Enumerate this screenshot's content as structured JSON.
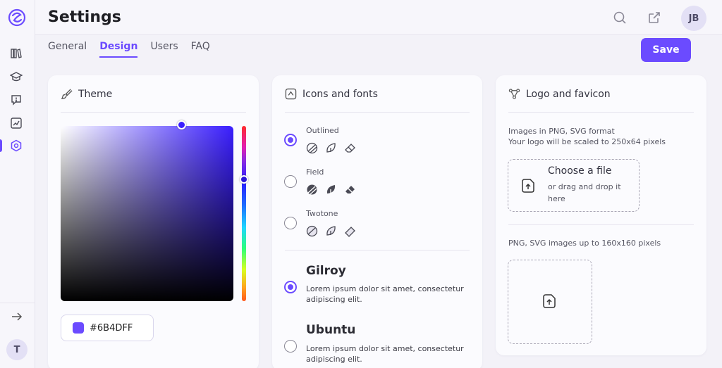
{
  "header": {
    "title": "Settings",
    "avatar_initials": "JB"
  },
  "sidebar": {
    "user_initial": "T"
  },
  "tabs": [
    {
      "label": "General",
      "active": false
    },
    {
      "label": "Design",
      "active": true
    },
    {
      "label": "Users",
      "active": false
    },
    {
      "label": "FAQ",
      "active": false
    }
  ],
  "toolbar": {
    "save_label": "Save"
  },
  "colors": {
    "accent": "#6B4BFF"
  },
  "theme": {
    "title": "Theme",
    "hex_value": "#6B4DFF"
  },
  "icons_fonts": {
    "title": "Icons and fonts",
    "icon_styles": [
      {
        "label": "Outlined",
        "selected": true
      },
      {
        "label": "Field",
        "selected": false
      },
      {
        "label": "Twotone",
        "selected": false
      }
    ],
    "fonts": [
      {
        "name": "Gilroy",
        "description": "Lorem ipsum dolor sit amet, consectetur adipiscing elit.",
        "selected": true
      },
      {
        "name": "Ubuntu",
        "description": "Lorem ipsum dolor sit amet, consectetur adipiscing elit.",
        "selected": false
      }
    ]
  },
  "logo_favicon": {
    "title": "Logo and favicon",
    "logo_hint_line1": "Images in PNG, SVG format",
    "logo_hint_line2": "Your logo will be scaled to 250x64 pixels",
    "upload_title": "Choose a file",
    "upload_sub": "or drag and drop it here",
    "favicon_hint": "PNG, SVG images up to 160x160 pixels"
  }
}
